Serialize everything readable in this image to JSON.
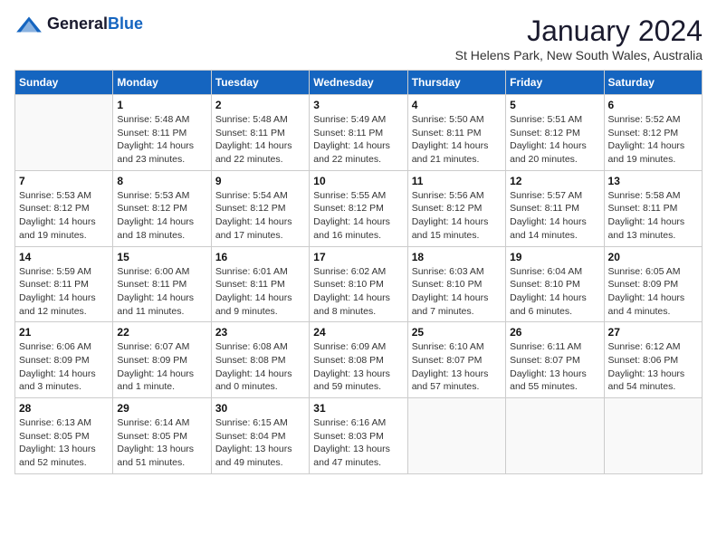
{
  "logo": {
    "general": "General",
    "blue": "Blue"
  },
  "title": "January 2024",
  "subtitle": "St Helens Park, New South Wales, Australia",
  "days_of_week": [
    "Sunday",
    "Monday",
    "Tuesday",
    "Wednesday",
    "Thursday",
    "Friday",
    "Saturday"
  ],
  "weeks": [
    [
      {
        "day": "",
        "info": ""
      },
      {
        "day": "1",
        "info": "Sunrise: 5:48 AM\nSunset: 8:11 PM\nDaylight: 14 hours\nand 23 minutes."
      },
      {
        "day": "2",
        "info": "Sunrise: 5:48 AM\nSunset: 8:11 PM\nDaylight: 14 hours\nand 22 minutes."
      },
      {
        "day": "3",
        "info": "Sunrise: 5:49 AM\nSunset: 8:11 PM\nDaylight: 14 hours\nand 22 minutes."
      },
      {
        "day": "4",
        "info": "Sunrise: 5:50 AM\nSunset: 8:11 PM\nDaylight: 14 hours\nand 21 minutes."
      },
      {
        "day": "5",
        "info": "Sunrise: 5:51 AM\nSunset: 8:12 PM\nDaylight: 14 hours\nand 20 minutes."
      },
      {
        "day": "6",
        "info": "Sunrise: 5:52 AM\nSunset: 8:12 PM\nDaylight: 14 hours\nand 19 minutes."
      }
    ],
    [
      {
        "day": "7",
        "info": "Sunrise: 5:53 AM\nSunset: 8:12 PM\nDaylight: 14 hours\nand 19 minutes."
      },
      {
        "day": "8",
        "info": "Sunrise: 5:53 AM\nSunset: 8:12 PM\nDaylight: 14 hours\nand 18 minutes."
      },
      {
        "day": "9",
        "info": "Sunrise: 5:54 AM\nSunset: 8:12 PM\nDaylight: 14 hours\nand 17 minutes."
      },
      {
        "day": "10",
        "info": "Sunrise: 5:55 AM\nSunset: 8:12 PM\nDaylight: 14 hours\nand 16 minutes."
      },
      {
        "day": "11",
        "info": "Sunrise: 5:56 AM\nSunset: 8:12 PM\nDaylight: 14 hours\nand 15 minutes."
      },
      {
        "day": "12",
        "info": "Sunrise: 5:57 AM\nSunset: 8:11 PM\nDaylight: 14 hours\nand 14 minutes."
      },
      {
        "day": "13",
        "info": "Sunrise: 5:58 AM\nSunset: 8:11 PM\nDaylight: 14 hours\nand 13 minutes."
      }
    ],
    [
      {
        "day": "14",
        "info": "Sunrise: 5:59 AM\nSunset: 8:11 PM\nDaylight: 14 hours\nand 12 minutes."
      },
      {
        "day": "15",
        "info": "Sunrise: 6:00 AM\nSunset: 8:11 PM\nDaylight: 14 hours\nand 11 minutes."
      },
      {
        "day": "16",
        "info": "Sunrise: 6:01 AM\nSunset: 8:11 PM\nDaylight: 14 hours\nand 9 minutes."
      },
      {
        "day": "17",
        "info": "Sunrise: 6:02 AM\nSunset: 8:10 PM\nDaylight: 14 hours\nand 8 minutes."
      },
      {
        "day": "18",
        "info": "Sunrise: 6:03 AM\nSunset: 8:10 PM\nDaylight: 14 hours\nand 7 minutes."
      },
      {
        "day": "19",
        "info": "Sunrise: 6:04 AM\nSunset: 8:10 PM\nDaylight: 14 hours\nand 6 minutes."
      },
      {
        "day": "20",
        "info": "Sunrise: 6:05 AM\nSunset: 8:09 PM\nDaylight: 14 hours\nand 4 minutes."
      }
    ],
    [
      {
        "day": "21",
        "info": "Sunrise: 6:06 AM\nSunset: 8:09 PM\nDaylight: 14 hours\nand 3 minutes."
      },
      {
        "day": "22",
        "info": "Sunrise: 6:07 AM\nSunset: 8:09 PM\nDaylight: 14 hours\nand 1 minute."
      },
      {
        "day": "23",
        "info": "Sunrise: 6:08 AM\nSunset: 8:08 PM\nDaylight: 14 hours\nand 0 minutes."
      },
      {
        "day": "24",
        "info": "Sunrise: 6:09 AM\nSunset: 8:08 PM\nDaylight: 13 hours\nand 59 minutes."
      },
      {
        "day": "25",
        "info": "Sunrise: 6:10 AM\nSunset: 8:07 PM\nDaylight: 13 hours\nand 57 minutes."
      },
      {
        "day": "26",
        "info": "Sunrise: 6:11 AM\nSunset: 8:07 PM\nDaylight: 13 hours\nand 55 minutes."
      },
      {
        "day": "27",
        "info": "Sunrise: 6:12 AM\nSunset: 8:06 PM\nDaylight: 13 hours\nand 54 minutes."
      }
    ],
    [
      {
        "day": "28",
        "info": "Sunrise: 6:13 AM\nSunset: 8:05 PM\nDaylight: 13 hours\nand 52 minutes."
      },
      {
        "day": "29",
        "info": "Sunrise: 6:14 AM\nSunset: 8:05 PM\nDaylight: 13 hours\nand 51 minutes."
      },
      {
        "day": "30",
        "info": "Sunrise: 6:15 AM\nSunset: 8:04 PM\nDaylight: 13 hours\nand 49 minutes."
      },
      {
        "day": "31",
        "info": "Sunrise: 6:16 AM\nSunset: 8:03 PM\nDaylight: 13 hours\nand 47 minutes."
      },
      {
        "day": "",
        "info": ""
      },
      {
        "day": "",
        "info": ""
      },
      {
        "day": "",
        "info": ""
      }
    ]
  ]
}
